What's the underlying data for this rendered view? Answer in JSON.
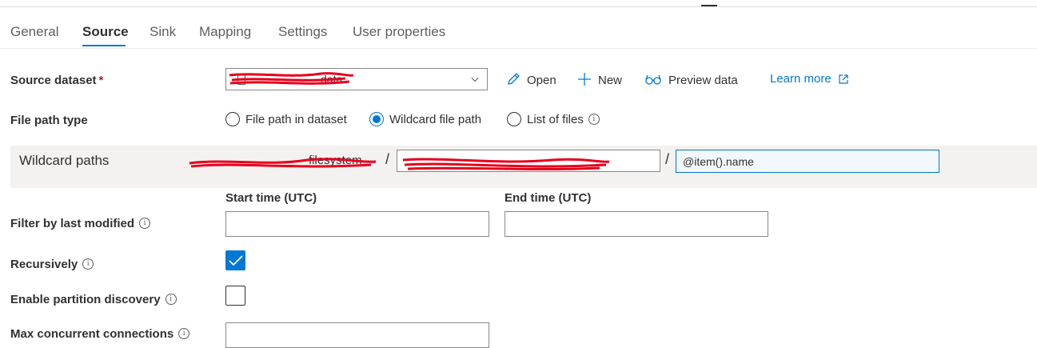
{
  "tabs": [
    "General",
    "Source",
    "Sink",
    "Mapping",
    "Settings",
    "User properties"
  ],
  "active_tab": "Source",
  "source_dataset": {
    "label": "Source dataset",
    "required_mark": "*",
    "value": "data",
    "actions": {
      "open": "Open",
      "new": "New",
      "preview": "Preview data",
      "learn_more": "Learn more"
    }
  },
  "file_path_type": {
    "label": "File path type",
    "options": [
      "File path in dataset",
      "Wildcard file path",
      "List of files"
    ],
    "selected": "Wildcard file path"
  },
  "wildcard_paths": {
    "label": "Wildcard paths",
    "container": "filesystem",
    "separator": "/",
    "folder_value": "",
    "file_value": "@item().name"
  },
  "filter_last_modified": {
    "label": "Filter by last modified",
    "start_label": "Start time (UTC)",
    "end_label": "End time (UTC)",
    "start_value": "",
    "end_value": ""
  },
  "recursively": {
    "label": "Recursively",
    "checked": true
  },
  "partition_discovery": {
    "label": "Enable partition discovery",
    "checked": false
  },
  "max_connections": {
    "label": "Max concurrent connections",
    "value": ""
  },
  "colors": {
    "accent": "#0078d4",
    "text": "#323130",
    "secondary_text": "#605e5c",
    "band": "#f3f2f1"
  }
}
